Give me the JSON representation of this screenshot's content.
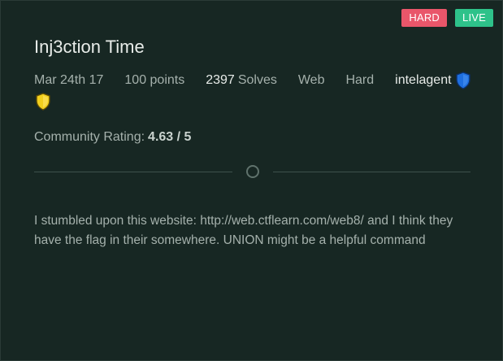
{
  "badges": {
    "difficulty": "HARD",
    "status": "LIVE",
    "difficulty_color": "#e9566a",
    "status_color": "#2ec28a"
  },
  "challenge": {
    "title": "Inj3ction Time",
    "date": "Mar 24th 17",
    "points": "100 points",
    "solves_count": "2397",
    "solves_label": "Solves",
    "category": "Web",
    "difficulty": "Hard",
    "author": "intelagent",
    "author_badges": [
      "blue-shield-icon",
      "yellow-shield-icon"
    ]
  },
  "rating": {
    "label": "Community Rating:",
    "value": "4.63 / 5"
  },
  "description": "I stumbled upon this website: http://web.ctflearn.com/web8/ and I think they have the flag in their somewhere. UNION might be a helpful command",
  "colors": {
    "card_background": "#172723",
    "text_muted": "#a5b1ac",
    "text_bright": "#e8ece9",
    "shield_blue": "#1e6fe0",
    "shield_yellow": "#f2cf1d"
  }
}
